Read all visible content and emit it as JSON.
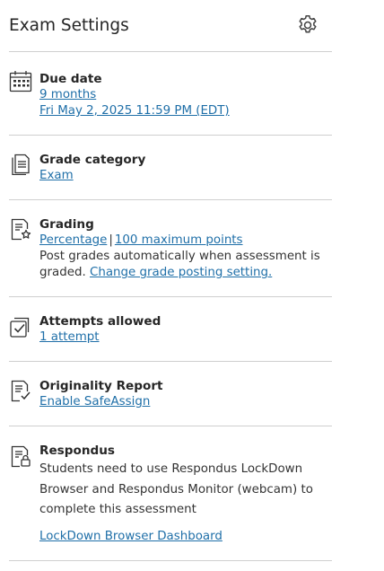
{
  "header": {
    "title": "Exam Settings",
    "settings_icon": "gear-icon"
  },
  "due_date": {
    "icon": "calendar-icon",
    "title": "Due date",
    "relative": "9 months",
    "absolute": "Fri May 2, 2025 11:59 PM (EDT)"
  },
  "grade_category": {
    "icon": "document-icon",
    "title": "Grade category",
    "value": "Exam"
  },
  "grading": {
    "icon": "document-star-icon",
    "title": "Grading",
    "schema": "Percentage",
    "separator": "|",
    "max_points": "100 maximum points",
    "posting_text": "Post grades automatically when assessment is graded.",
    "posting_link": "Change grade posting setting."
  },
  "attempts": {
    "icon": "checkbox-stack-icon",
    "title": "Attempts allowed",
    "value": "1 attempt"
  },
  "originality": {
    "icon": "document-check-icon",
    "title": "Originality Report",
    "link": "Enable SafeAssign"
  },
  "respondus": {
    "icon": "document-lock-icon",
    "title": "Respondus",
    "description": "Students need to use Respondus LockDown Browser and Respondus Monitor (webcam) to complete this assessment",
    "link": "LockDown Browser Dashboard"
  },
  "colors": {
    "link": "#1f6fa8",
    "divider": "#cfcfcf",
    "text": "#262626"
  }
}
